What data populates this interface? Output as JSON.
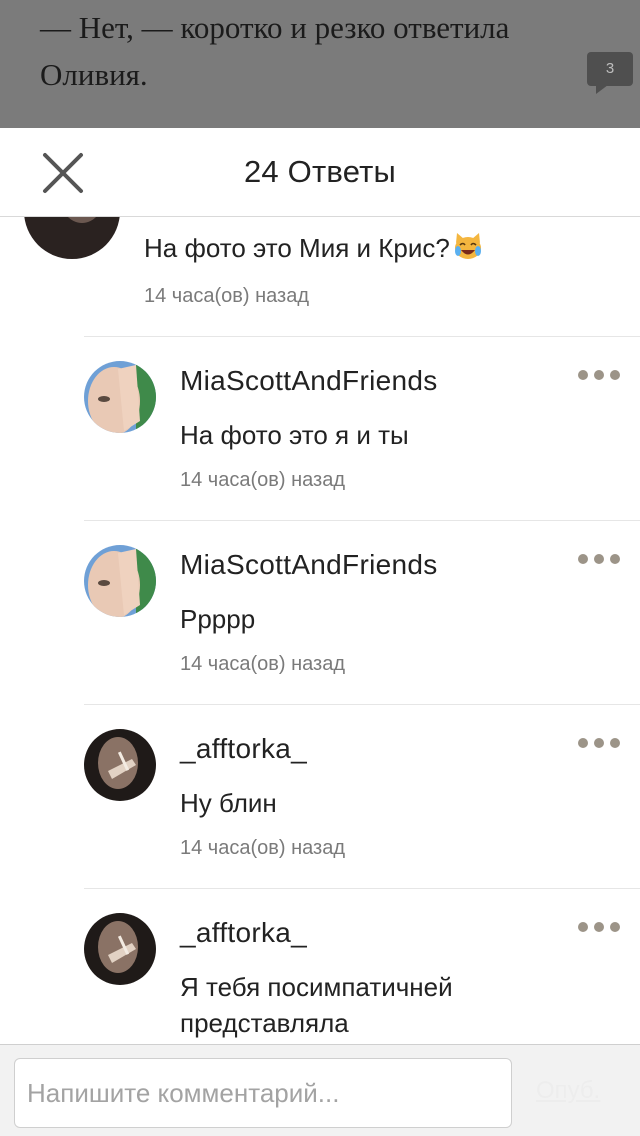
{
  "story": {
    "paragraph": "— Нет, — коротко и резко ответила Оливия.",
    "comment_count": "3"
  },
  "header": {
    "title": "24 Ответы",
    "close_icon": "close-icon"
  },
  "parent_comment": {
    "text": "На фото это Мия и Крис?",
    "emoji": "crying-laughing-cat-emoji",
    "time": "14 часа(ов) назад"
  },
  "replies": [
    {
      "author": "MiaScottAndFriends",
      "text": "На фото это я и ты",
      "time": "14 часа(ов) назад",
      "avatar": "light-avatar"
    },
    {
      "author": "MiaScottAndFriends",
      "text": "Ррррр",
      "time": "14 часа(ов) назад",
      "avatar": "light-avatar"
    },
    {
      "author": "_afftorka_",
      "text": "Ну блин",
      "time": "14 часа(ов) назад",
      "avatar": "dark-avatar"
    },
    {
      "author": "_afftorka_",
      "text": "Я тебя посимпатичней представляла",
      "time": "",
      "avatar": "dark-avatar"
    }
  ],
  "footer": {
    "input_placeholder": "Напишите комментарий...",
    "input_value": "",
    "publish_label": "Опуб."
  },
  "colors": {
    "dim_overlay": "#7b7b7b",
    "meta_text": "#7a7a7a",
    "more_dots": "#9c9488",
    "divider": "#e6e6e6"
  }
}
